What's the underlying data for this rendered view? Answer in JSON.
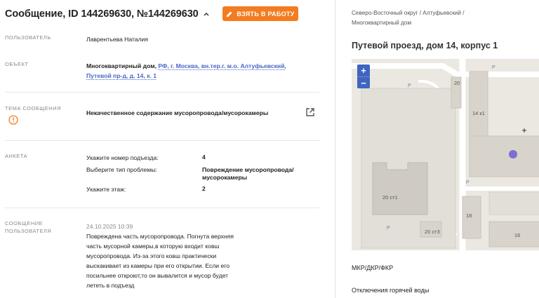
{
  "header": {
    "title": "Сообщение, ID 144269630, №144269630",
    "take_button": "ВЗЯТЬ В РАБОТУ"
  },
  "user": {
    "label": "ПОЛЬЗОВАТЕЛЬ",
    "value": "Лаврентьева Наталия"
  },
  "object": {
    "label": "ОБЪЕКТ",
    "type": "Многоквартирный дом,",
    "link_line1": "РФ, г. Москва, вн.тер.г. м.о. Алтуфьевский,",
    "link_line2": "Путевой пр-д, д. 14, к. 1"
  },
  "topic": {
    "label": "ТЕМА СООБЩЕНИЯ",
    "value": "Некачественное содержание мусоропровода/мусорокамеры"
  },
  "survey": {
    "label": "АНКЕТА",
    "rows": [
      {
        "q": "Укажите номер подъезда:",
        "a": "4"
      },
      {
        "q": "Выберите тип проблемы:",
        "a": "Повреждение мусоропровода/",
        "a2": "мусорокамеры"
      },
      {
        "q": "Укажите этаж:",
        "a": "2"
      }
    ]
  },
  "message": {
    "label_line1": "СООБЩЕНИЕ",
    "label_line2": "ПОЛЬЗОВАТЕЛЯ",
    "date": "24.10.2025 10:39",
    "lines": [
      "Повреждена часть мусоропровода. Погнута верхняя",
      "часть мусорной камеры,в которую входит ковш",
      "мусоропровода. Из-за этого ковш практически",
      "выскакивает из камеры при его открытии. Если его",
      "посильнее откроют,то он вывалится и мусор будет",
      "лететь в подъезд"
    ]
  },
  "right": {
    "crumb_line1": "Северо-Восточный округ / Алтуфьевский /",
    "crumb_line2": "Многоквартирный дом",
    "address": "Путевой проезд, дом 14, корпус 1",
    "map": {
      "zoom_in": "+",
      "zoom_out": "−",
      "labels": [
        "20",
        "14 к1",
        "20 ст1",
        "20 ст3",
        "18",
        "16"
      ],
      "parking": "P"
    },
    "section1": "МКР/ДКР/ФКР",
    "section2": "Отключения горячей воды"
  },
  "colors": {
    "accent": "#f47c20",
    "link": "#4a67c9",
    "warning": "#f47c20",
    "map_marker": "#7b6fd6",
    "zoom": "#3f64c2"
  }
}
